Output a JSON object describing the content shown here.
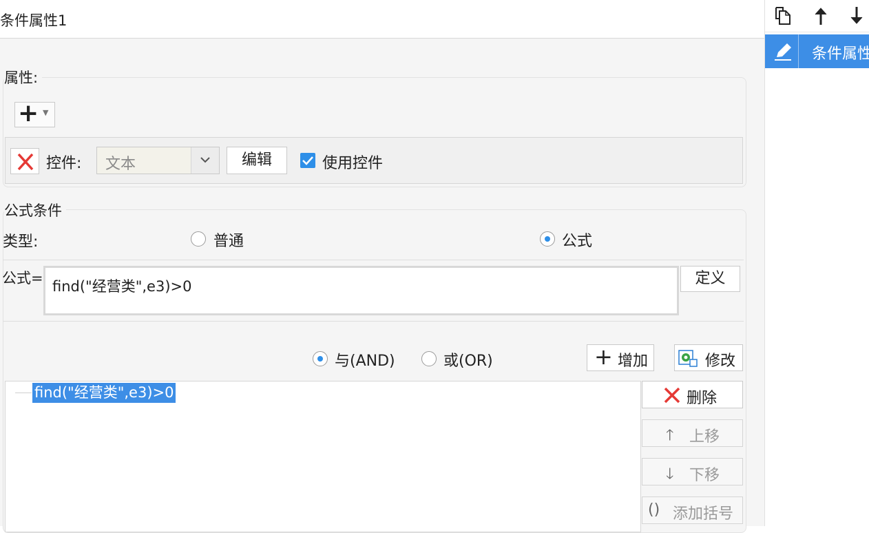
{
  "colors": {
    "accent": "#2e8fe8",
    "selection": "#3d8ee6",
    "delete_red": "#e53935",
    "panel_bg": "#f5f5f5"
  },
  "header": {
    "title": "条件属性1"
  },
  "attributes": {
    "group_label": "属性:",
    "add_button_icon": "plus-icon",
    "control_label": "控件:",
    "control_select_value": "文本",
    "edit_button": "编辑",
    "use_control_label": "使用控件",
    "use_control_checked": true
  },
  "formula_condition": {
    "group_label": "公式条件",
    "type_label": "类型:",
    "type_options": [
      {
        "label": "普通",
        "checked": false
      },
      {
        "label": "公式",
        "checked": true
      }
    ],
    "formula_label": "公式=",
    "formula_value": "find(\"经营类\",e3)>0",
    "define_button": "定义",
    "logic_options": [
      {
        "label": "与(AND)",
        "checked": true
      },
      {
        "label": "或(OR)",
        "checked": false
      }
    ],
    "add_button": "增加",
    "modify_button": "修改",
    "delete_button": "删除",
    "move_up_button": "上移",
    "move_down_button": "下移",
    "add_bracket_button": "添加括号",
    "conditions": [
      "find(\"经营类\",e3)>0"
    ]
  },
  "right_panel": {
    "toolbar_icons": [
      "copy-icon",
      "arrow-up-icon",
      "arrow-down-icon"
    ],
    "items": [
      {
        "label": "条件属性",
        "selected": true
      }
    ]
  }
}
